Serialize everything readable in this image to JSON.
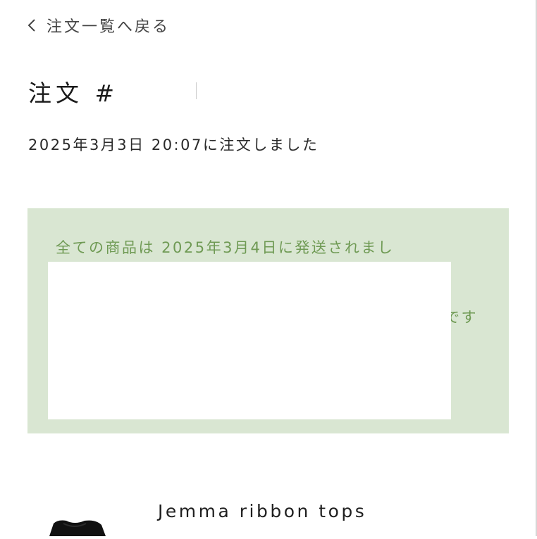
{
  "nav": {
    "back_label": "注文一覧へ戻る"
  },
  "order": {
    "title": "注文 #",
    "placed_at": "2025年3月3日 20:07に注文しました"
  },
  "shipping_status": {
    "message": "全ての商品は 2025年3月4日に発送されまし",
    "message_tail": "です",
    "background": "#d9e6d2",
    "text_color": "#6f9a54"
  },
  "products": [
    {
      "name": "Jemma ribbon tops"
    }
  ]
}
